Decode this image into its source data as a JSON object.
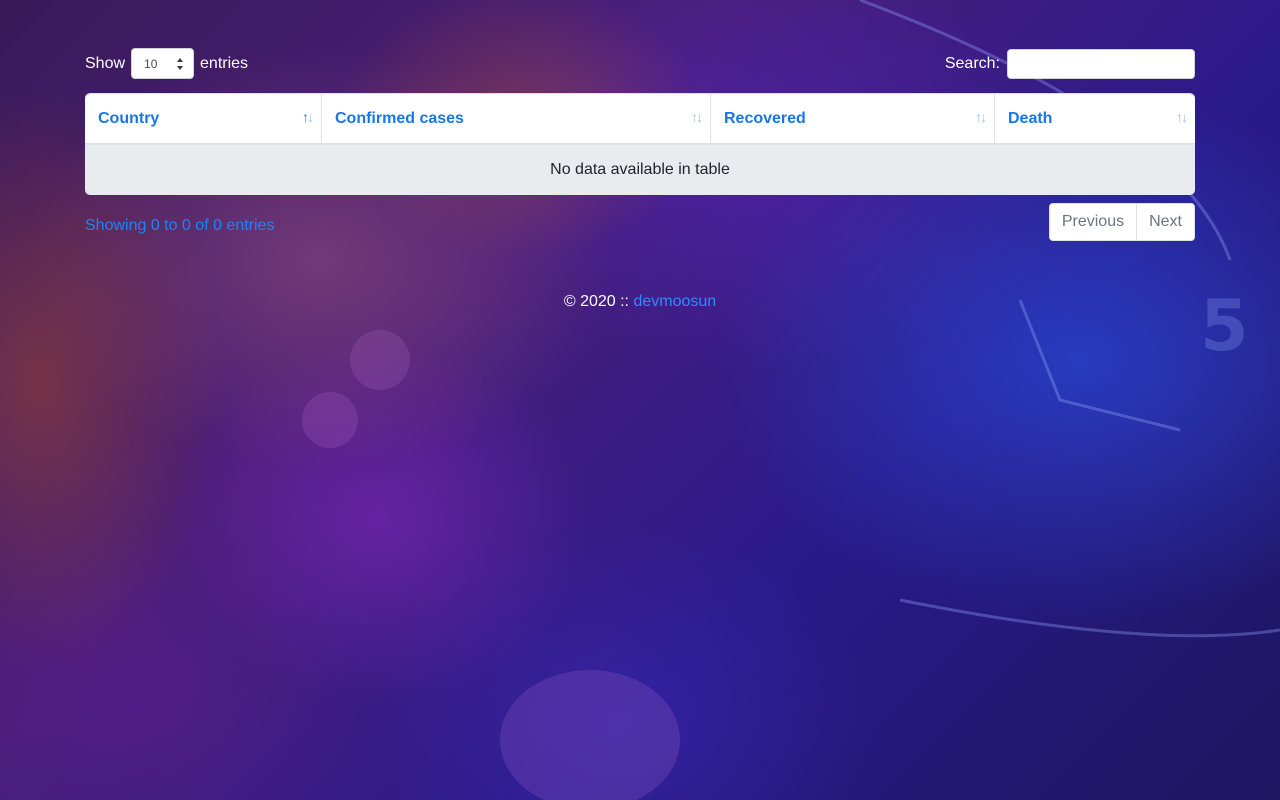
{
  "length_control": {
    "show_label": "Show",
    "selected_value": "10",
    "entries_label": "entries"
  },
  "search": {
    "label": "Search:",
    "value": "",
    "placeholder": ""
  },
  "table": {
    "columns": [
      "Country",
      "Confirmed cases",
      "Recovered",
      "Death"
    ],
    "empty_message": "No data available in table",
    "sort_icon": "sort-arrows-icon"
  },
  "info_text": "Showing 0 to 0 of 0 entries",
  "pagination": {
    "previous": "Previous",
    "next": "Next"
  },
  "footer": {
    "prefix": "© 2020 ::",
    "link_text": "devmoosun"
  },
  "colors": {
    "accent": "#1877e8",
    "link": "#2f8cff"
  }
}
